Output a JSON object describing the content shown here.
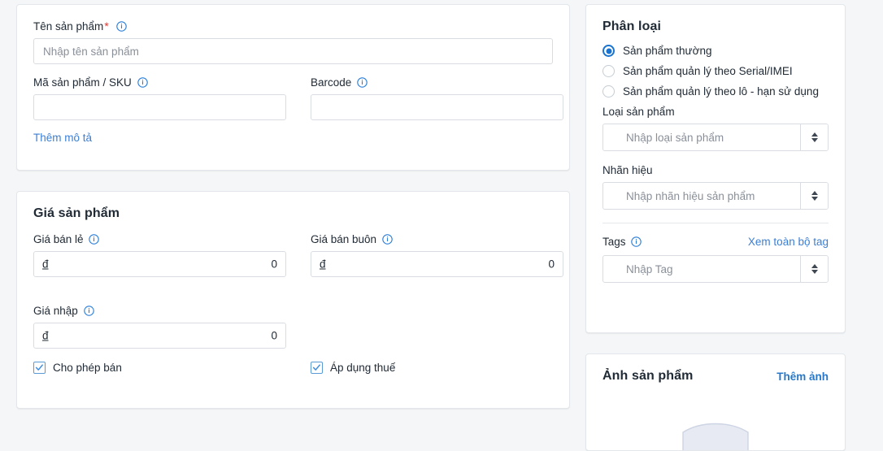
{
  "theme": {
    "page_bg": "#f4f6f8",
    "card_bg": "#ffffff",
    "border": "#d9dde2",
    "text": "#212b36",
    "link": "#3a7fd5",
    "accent": "#1a73cf",
    "required": "#e3342f",
    "placeholder": "#8a9099"
  },
  "product_info": {
    "name_label": "Tên sản phẩm",
    "name_required_mark": "*",
    "name_placeholder": "Nhập tên sản phẩm",
    "name_value": "",
    "sku_label": "Mã sản phẩm / SKU",
    "sku_value": "",
    "sku_placeholder": "",
    "barcode_label": "Barcode",
    "barcode_value": "",
    "barcode_placeholder": "",
    "add_description_link": "Thêm mô tả"
  },
  "price": {
    "title": "Giá sản phẩm",
    "retail_label": "Giá bán lẻ",
    "retail_currency": "đ",
    "retail_value": "0",
    "wholesale_label": "Giá bán buôn",
    "wholesale_currency": "đ",
    "wholesale_value": "0",
    "import_label": "Giá nhập",
    "import_currency": "đ",
    "import_value": "0",
    "allow_sell_label": "Cho phép bán",
    "allow_sell_checked": true,
    "apply_tax_label": "Áp dụng thuế",
    "apply_tax_checked": true
  },
  "classification": {
    "title": "Phân loại",
    "options": [
      {
        "label": "Sản phẩm thường",
        "selected": true
      },
      {
        "label": "Sản phẩm quản lý theo Serial/IMEI",
        "selected": false
      },
      {
        "label": "Sản phẩm quản lý theo lô - hạn sử dụng",
        "selected": false
      }
    ],
    "type_label": "Loại sản phẩm",
    "type_placeholder": "Nhập loại sản phẩm",
    "type_value": "",
    "brand_label": "Nhãn hiệu",
    "brand_placeholder": "Nhập nhãn hiệu sản phẩm",
    "brand_value": "",
    "tags_label": "Tags",
    "tags_view_all_link": "Xem toàn bộ tag",
    "tags_placeholder": "Nhập Tag",
    "tags_value": ""
  },
  "images": {
    "title": "Ảnh sản phẩm",
    "add_link": "Thêm ảnh"
  }
}
